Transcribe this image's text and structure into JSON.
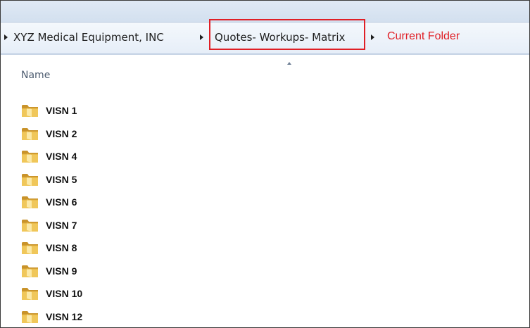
{
  "breadcrumb": {
    "parent": "XYZ Medical Equipment, INC",
    "current": "Quotes- Workups- Matrix"
  },
  "annotation": {
    "label": "Current Folder",
    "color": "#e01f26"
  },
  "column_header": {
    "name": "Name"
  },
  "folders": [
    {
      "name": "VISN 1"
    },
    {
      "name": "VISN 2"
    },
    {
      "name": "VISN 4"
    },
    {
      "name": "VISN 5"
    },
    {
      "name": "VISN 6"
    },
    {
      "name": "VISN 7"
    },
    {
      "name": "VISN 8"
    },
    {
      "name": "VISN 9"
    },
    {
      "name": "VISN 10"
    },
    {
      "name": "VISN 12"
    }
  ],
  "icons": {
    "folder": "folder-icon",
    "breadcrumb_separator": "chevron-right-icon",
    "sort": "sort-ascending-icon"
  }
}
